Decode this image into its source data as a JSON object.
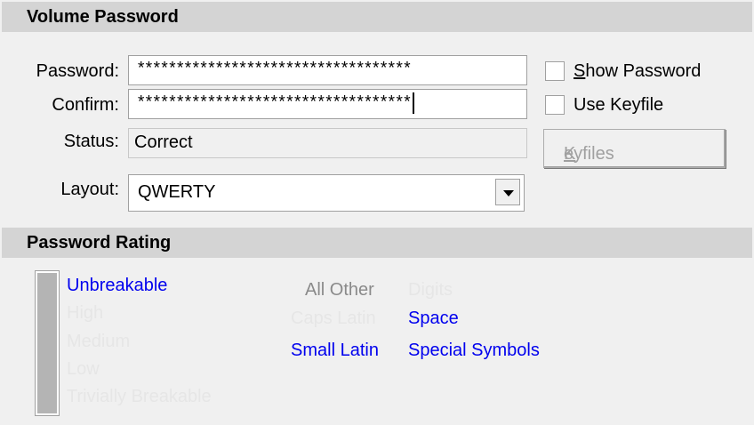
{
  "volume_password": {
    "header": "Volume Password",
    "password_label": "Password:",
    "password_value": "***********************************",
    "confirm_label": "Confirm:",
    "confirm_value": "***********************************",
    "status_label": "Status:",
    "status_value": "Correct",
    "layout_label": "Layout:",
    "layout_value": "QWERTY",
    "show_password": {
      "label_u": "S",
      "label_rest": "how Password",
      "checked": false
    },
    "use_keyfile": {
      "label": "Use Keyfile",
      "checked": false
    },
    "keyfiles_button": {
      "label_u": "K",
      "label_rest": "eyfiles",
      "enabled": false
    }
  },
  "password_rating": {
    "header": "Password Rating",
    "meter_icon": "strength-meter-bar",
    "levels": [
      "Unbreakable",
      "High",
      "Medium",
      "Low",
      "Trivially Breakable"
    ],
    "current_level": "Unbreakable",
    "categories": {
      "all_other": "All Other",
      "digits": "Digits",
      "caps_latin": "Caps Latin",
      "space": "Space",
      "small_latin": "Small Latin",
      "special_symbols": "Special Symbols"
    }
  },
  "colors": {
    "active": "#0000ee",
    "inactive": "#e6e6e6",
    "header_bg": "#d4d4d4",
    "window_bg": "#f0f0f0"
  }
}
